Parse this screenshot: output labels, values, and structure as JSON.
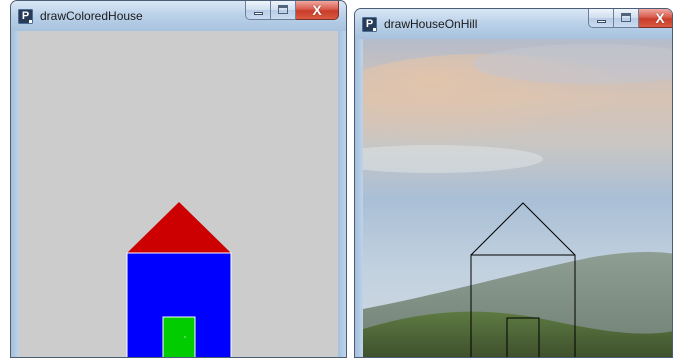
{
  "windows": [
    {
      "title": "drawColoredHouse",
      "icon": "processing-app-icon",
      "icon_letter": "P",
      "canvas_background": "#cccccc",
      "roof_color": "#cc0000",
      "wall_color": "#0000ff",
      "door_color": "#00cc00",
      "outline_color": "#ffffff"
    },
    {
      "title": "drawHouseOnHill",
      "icon": "processing-app-icon",
      "icon_letter": "P",
      "outline_color": "#000000"
    }
  ],
  "caption_buttons": {
    "minimize_icon": "minimize-icon",
    "maximize_icon": "maximize-icon",
    "close_icon": "close-icon",
    "close_glyph": "X"
  }
}
